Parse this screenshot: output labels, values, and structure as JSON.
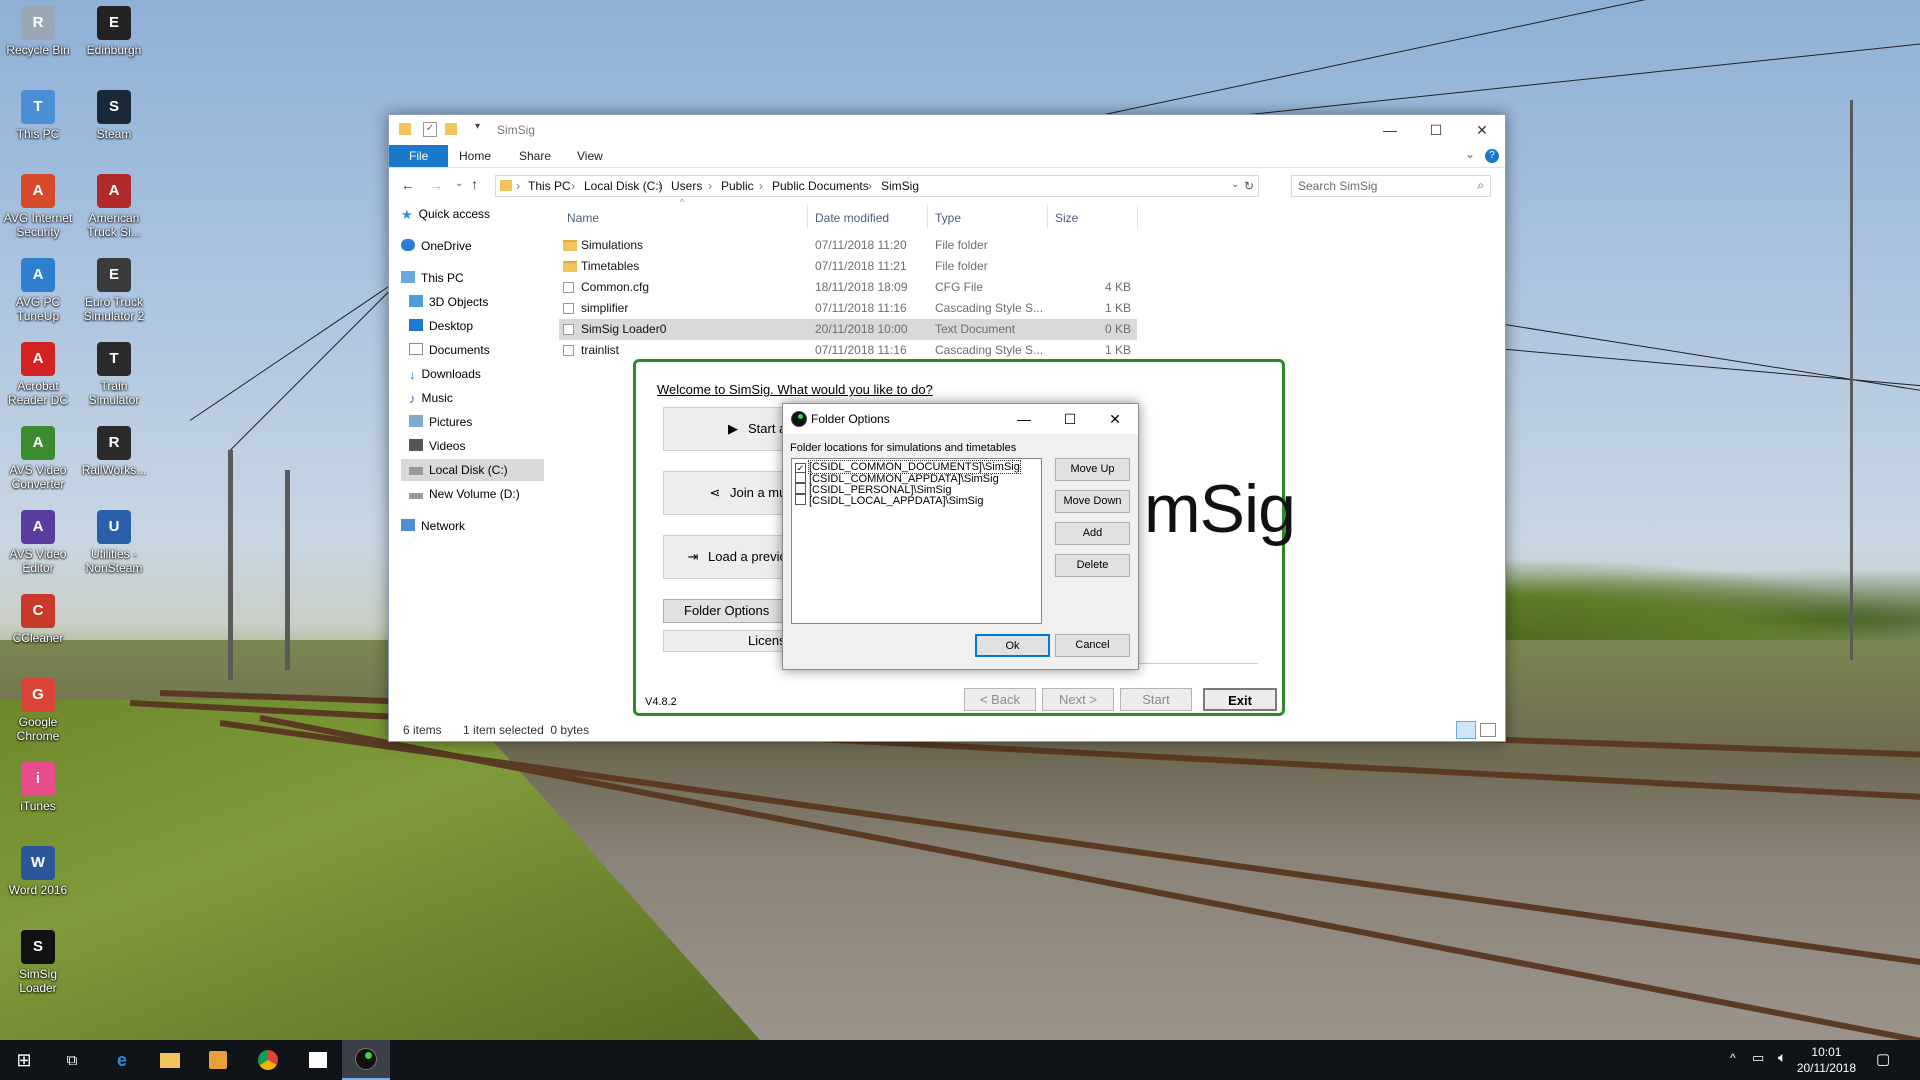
{
  "desktop": {
    "icons": [
      {
        "label": "Recycle Bin",
        "icon": "recycle-bin-icon",
        "color": "#9aa7b5"
      },
      {
        "label": "Edinburgh",
        "icon": "simsig-shortcut-icon",
        "color": "#222222"
      },
      {
        "label": "This PC",
        "icon": "computer-icon",
        "color": "#4a8fd6"
      },
      {
        "label": "Steam",
        "icon": "steam-icon",
        "color": "#1b2838"
      },
      {
        "label": "AVG Internet Security",
        "icon": "avg-icon",
        "color": "#d84b2a"
      },
      {
        "label": "American Truck Si...",
        "icon": "truck-icon",
        "color": "#b12a2a"
      },
      {
        "label": "AVG PC TuneUp",
        "icon": "tuneup-icon",
        "color": "#2f7fd1"
      },
      {
        "label": "Euro Truck Simulator 2",
        "icon": "truck-icon",
        "color": "#3a3a3a"
      },
      {
        "label": "Acrobat Reader DC",
        "icon": "acrobat-icon",
        "color": "#d42222"
      },
      {
        "label": "Train Simulator",
        "icon": "train-simulator-icon",
        "color": "#2b2b2b"
      },
      {
        "label": "AVS Video Converter",
        "icon": "video-converter-icon",
        "color": "#3a8c2f"
      },
      {
        "label": "RailWorks...",
        "icon": "railworks-icon",
        "color": "#2b2b2b"
      },
      {
        "label": "AVS Video Editor",
        "icon": "video-editor-icon",
        "color": "#5a3ca0"
      },
      {
        "label": "Utilities - NonSteam",
        "icon": "utilities-icon",
        "color": "#2b5faa"
      },
      {
        "label": "CCleaner",
        "icon": "ccleaner-icon",
        "color": "#c8392b"
      },
      {
        "label": "Google Chrome",
        "icon": "chrome-icon",
        "color": "#db4437"
      },
      {
        "label": "iTunes",
        "icon": "itunes-icon",
        "color": "#e84c8b"
      },
      {
        "label": "Word 2016",
        "icon": "word-icon",
        "color": "#2b579a"
      },
      {
        "label": "SimSig Loader",
        "icon": "simsig-loader-icon",
        "color": "#111111"
      }
    ]
  },
  "explorer": {
    "title": "SimSig",
    "tabs": [
      "File",
      "Home",
      "Share",
      "View"
    ],
    "breadcrumb": [
      "This PC",
      "Local Disk (C:)",
      "Users",
      "Public",
      "Public Documents",
      "SimSig"
    ],
    "search_placeholder": "Search SimSig",
    "nav": {
      "quick_access": "Quick access",
      "onedrive": "OneDrive",
      "this_pc": "This PC",
      "objects3d": "3D Objects",
      "desktop": "Desktop",
      "documents": "Documents",
      "downloads": "Downloads",
      "music": "Music",
      "pictures": "Pictures",
      "videos": "Videos",
      "local_disk": "Local Disk (C:)",
      "new_volume": "New Volume (D:)",
      "network": "Network"
    },
    "columns": {
      "name": "Name",
      "date": "Date modified",
      "type": "Type",
      "size": "Size"
    },
    "files": [
      {
        "name": "Simulations",
        "date": "07/11/2018 11:20",
        "type": "File folder",
        "size": "",
        "kind": "folder"
      },
      {
        "name": "Timetables",
        "date": "07/11/2018 11:21",
        "type": "File folder",
        "size": "",
        "kind": "folder"
      },
      {
        "name": "Common.cfg",
        "date": "18/11/2018 18:09",
        "type": "CFG File",
        "size": "4 KB",
        "kind": "file"
      },
      {
        "name": "simplifier",
        "date": "07/11/2018 11:16",
        "type": "Cascading Style S...",
        "size": "1 KB",
        "kind": "css"
      },
      {
        "name": "SimSig Loader0",
        "date": "20/11/2018 10:00",
        "type": "Text Document",
        "size": "0 KB",
        "kind": "text",
        "selected": true
      },
      {
        "name": "trainlist",
        "date": "07/11/2018 11:16",
        "type": "Cascading Style S...",
        "size": "1 KB",
        "kind": "css"
      }
    ],
    "status": {
      "items": "6 items",
      "selection": "1 item selected  0 bytes"
    }
  },
  "loader": {
    "welcome": "Welcome to SimSig. What would you like to do?",
    "start_label": "Start a",
    "join_label": "Join a mul",
    "load_label": "Load a previo",
    "folder_options_label": "Folder Options",
    "license_label": "Licens",
    "logo_text": "mSig",
    "version": "V4.8.2",
    "back_label": "< Back",
    "next_label": "Next >",
    "start_wiz_label": "Start",
    "exit_label": "Exit",
    "border_color": "#2c8a2c"
  },
  "dialog": {
    "title": "Folder Options",
    "label": "Folder locations for simulations and timetables",
    "items": [
      {
        "text": "[CSIDL_COMMON_DOCUMENTS]\\SimSig",
        "checked": true
      },
      {
        "text": "[CSIDL_COMMON_APPDATA]\\SimSig",
        "checked": false
      },
      {
        "text": "[CSIDL_PERSONAL]\\SimSig",
        "checked": false
      },
      {
        "text": "[CSIDL_LOCAL_APPDATA]\\SimSig",
        "checked": false
      }
    ],
    "move_up": "Move Up",
    "move_down": "Move Down",
    "add": "Add",
    "delete": "Delete",
    "ok": "Ok",
    "cancel": "Cancel"
  },
  "taskbar": {
    "time": "10:01",
    "date": "20/11/2018"
  }
}
